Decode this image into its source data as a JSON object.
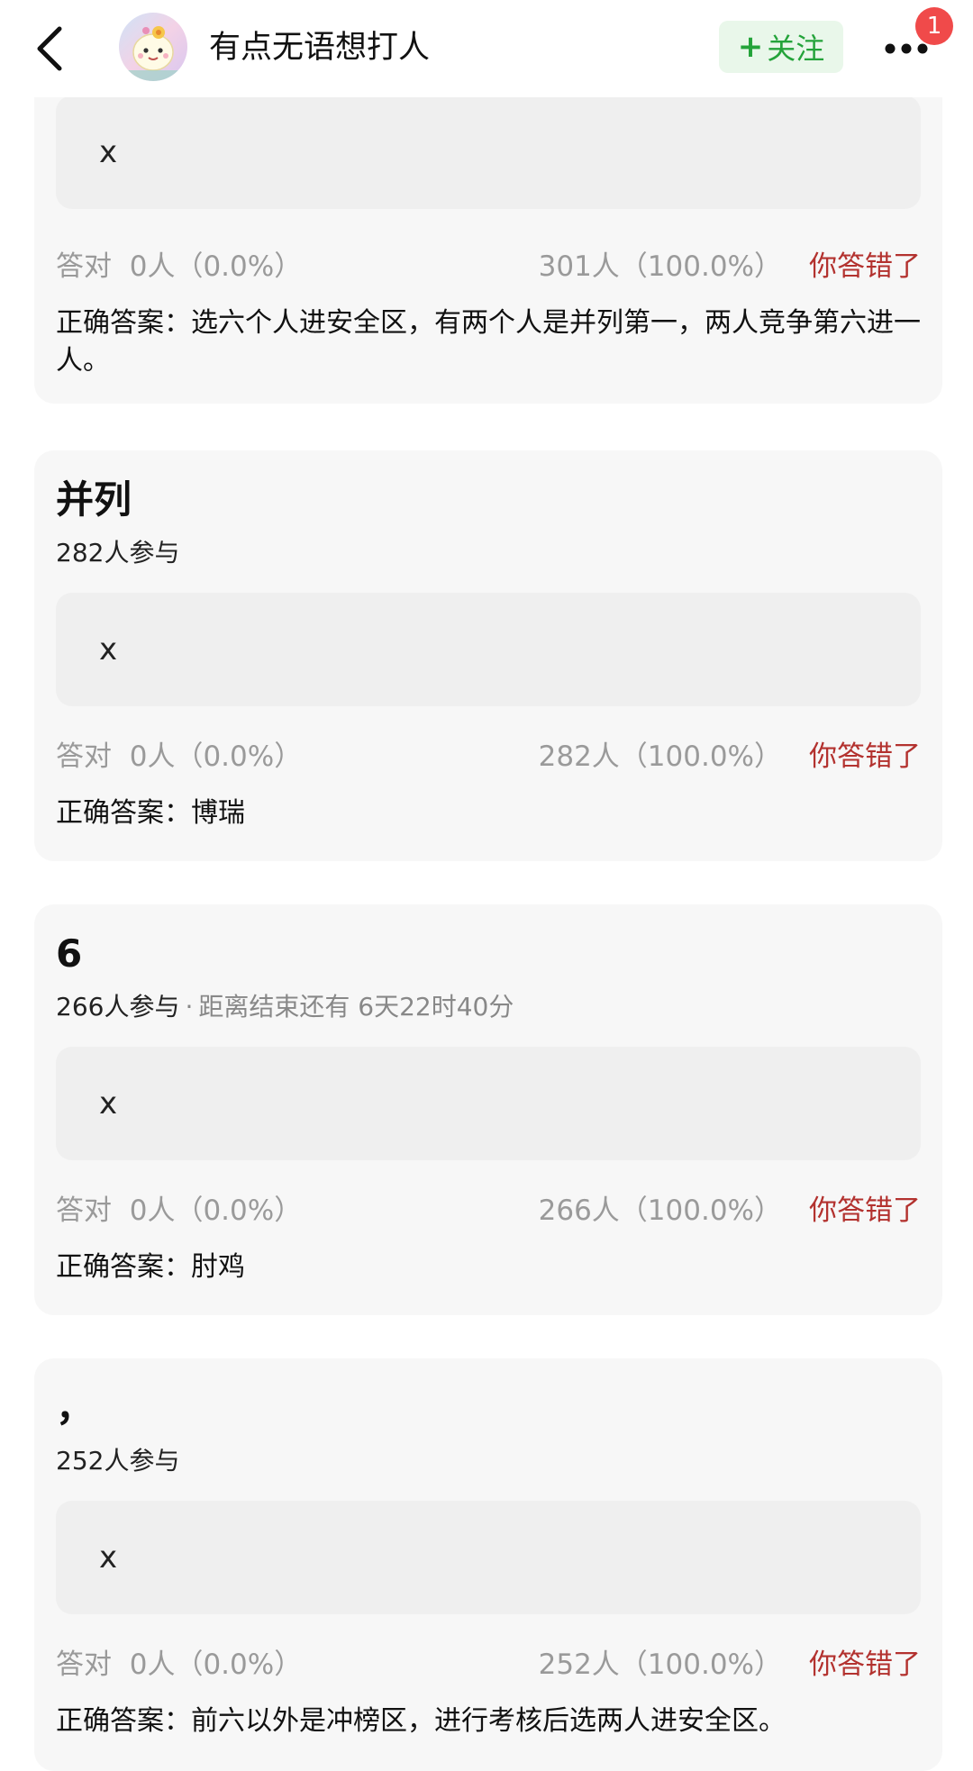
{
  "header": {
    "username": "有点无语想打人",
    "follow_label": "关注",
    "follow_plus": "+",
    "badge_count": "1"
  },
  "cards": [
    {
      "option": "x",
      "correct_label": "答对",
      "correct_stat": "0人（0.0%）",
      "wrong_stat": "301人（100.0%）",
      "result": "你答错了",
      "answer": "正确答案：选六个人进安全区，有两个人是并列第一，两人竞争第六进一人。"
    },
    {
      "title": "并列",
      "participants": "282人参与",
      "option": "x",
      "correct_label": "答对",
      "correct_stat": "0人（0.0%）",
      "wrong_stat": "282人（100.0%）",
      "result": "你答错了",
      "answer": "正确答案：博瑞"
    },
    {
      "title": "6",
      "participants": "266人参与",
      "dot": "·",
      "deadline": "距离结束还有 6天22时40分",
      "option": "x",
      "correct_label": "答对",
      "correct_stat": "0人（0.0%）",
      "wrong_stat": "266人（100.0%）",
      "result": "你答错了",
      "answer": "正确答案：肘鸡"
    },
    {
      "title": "，",
      "participants": "252人参与",
      "option": "x",
      "correct_label": "答对",
      "correct_stat": "0人（0.0%）",
      "wrong_stat": "252人（100.0%）",
      "result": "你答错了",
      "answer": "正确答案：前六以外是冲榜区，进行考核后选两人进安全区。"
    }
  ],
  "icons": {
    "back": "chevron-left-icon",
    "more": "more-dots-icon",
    "avatar": "avatar-image"
  },
  "colors": {
    "follow_text": "#24a33a",
    "follow_bg": "#e9f7ea",
    "wrong_result": "#b3322f",
    "badge": "#f04a4a",
    "card_bg": "#f7f7f7",
    "option_bg": "#efefef"
  }
}
